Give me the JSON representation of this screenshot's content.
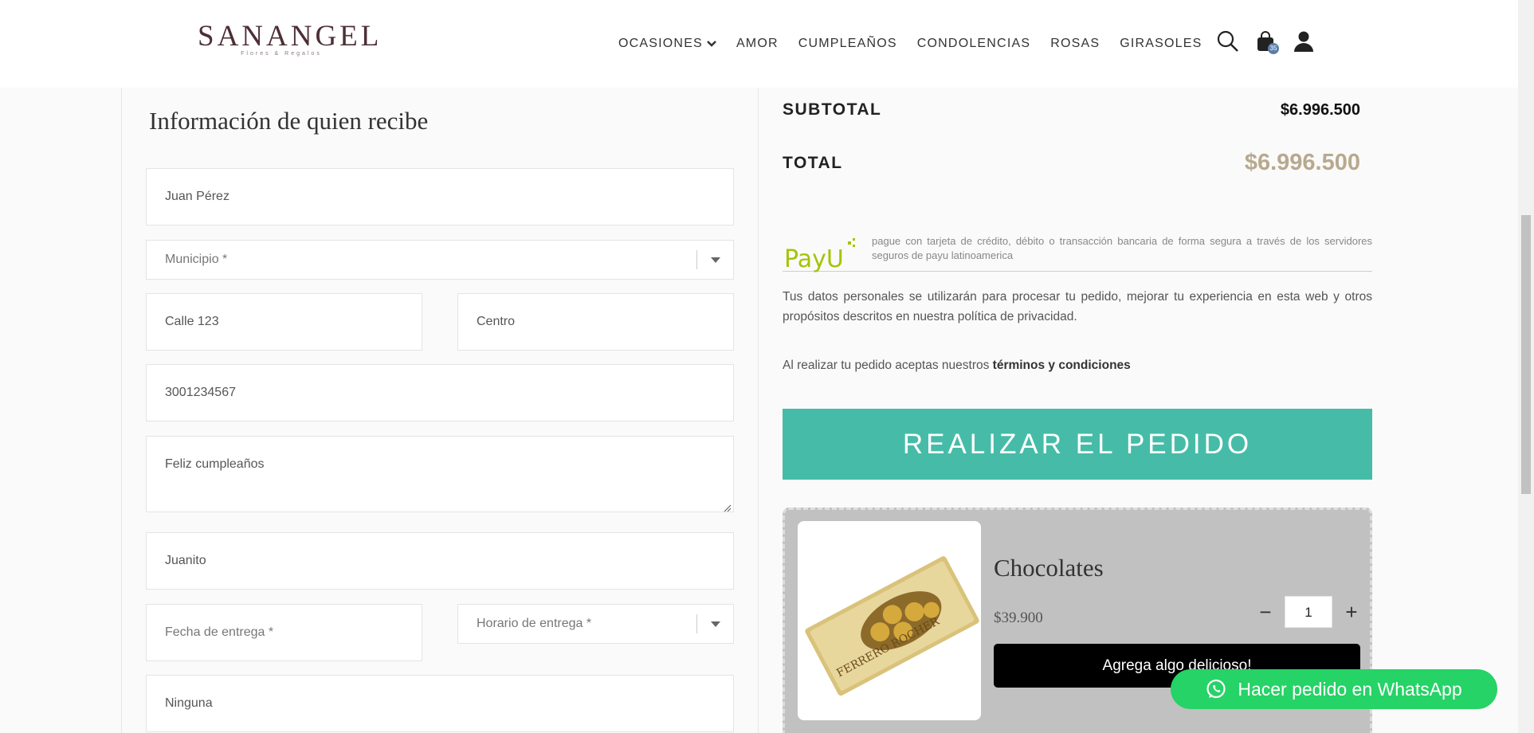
{
  "header": {
    "logo_main": "SANANGEL",
    "logo_sub": "Flores & Regalos",
    "nav": [
      "OCASIONES",
      "AMOR",
      "CUMPLEAÑOS",
      "CONDOLENCIAS",
      "ROSAS",
      "GIRASOLES"
    ],
    "cart_count": "35"
  },
  "form": {
    "title": "Información de quien recibe",
    "name": "Juan Pérez",
    "municipio_placeholder": "Municipio *",
    "street": "Calle 123",
    "neighborhood": "Centro",
    "phone": "3001234567",
    "message": "Feliz cumpleaños",
    "signature": "Juanito",
    "date_placeholder": "Fecha de entrega *",
    "time_placeholder": "Horario de entrega *",
    "notes": "Ninguna"
  },
  "summary": {
    "subtotal_label": "SUBTOTAL",
    "subtotal_value": "$6.996.500",
    "total_label": "TOTAL",
    "total_value": "$6.996.500",
    "payu_text": "pague con tarjeta de crédito, débito o transacción bancaria de forma segura a través de los servidores seguros de payu latinoamerica",
    "privacy_text": "Tus datos personales se utilizarán para procesar tu pedido, mejorar tu experiencia en esta web y otros propósitos descritos en nuestra política de privacidad.",
    "terms_prefix": "Al realizar tu pedido aceptas nuestros ",
    "terms_link": "términos y condiciones",
    "place_order": "REALIZAR EL PEDIDO"
  },
  "upsell": {
    "name": "Chocolates",
    "price": "$39.900",
    "qty": "1",
    "minus": "−",
    "plus": "+",
    "add_label": "Agrega algo delicioso!",
    "box_text": "FERRERO ROCHER"
  },
  "whatsapp": {
    "label": "Hacer pedido en WhatsApp"
  },
  "colors": {
    "accent": "#46bca8",
    "whatsapp": "#25d366",
    "total": "#b8a98e",
    "logo": "#4d2f36"
  }
}
